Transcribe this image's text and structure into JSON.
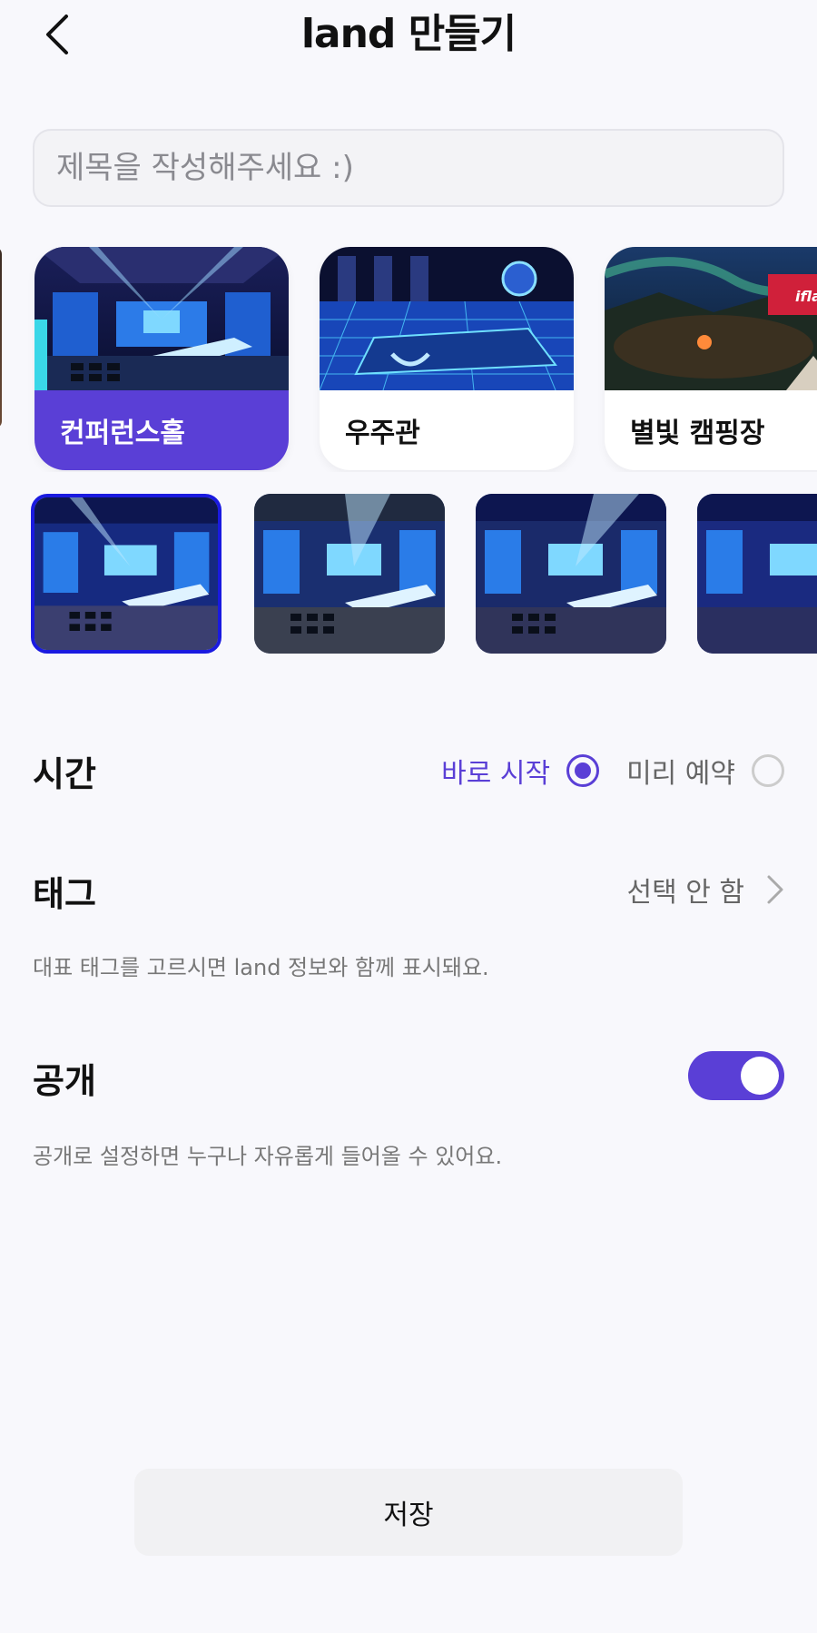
{
  "header": {
    "title": "land 만들기"
  },
  "title_input": {
    "placeholder": "제목을 작성해주세요 :)"
  },
  "lands": [
    {
      "label": "컨퍼런스홀",
      "selected": true
    },
    {
      "label": "우주관",
      "selected": false
    },
    {
      "label": "별빛 캠핑장",
      "selected": false,
      "badge": "ifland"
    }
  ],
  "time": {
    "label": "시간",
    "options": [
      {
        "label": "바로 시작",
        "selected": true
      },
      {
        "label": "미리 예약",
        "selected": false
      }
    ]
  },
  "tag": {
    "label": "태그",
    "value": "선택 안 함",
    "help": "대표 태그를 고르시면 land 정보와 함께 표시돼요."
  },
  "public": {
    "label": "공개",
    "enabled": true,
    "help": "공개로 설정하면 누구나 자유롭게 들어올 수 있어요."
  },
  "save_button": {
    "label": "저장"
  },
  "colors": {
    "accent": "#5a3fd6",
    "background": "#f8f8fc",
    "selected_thumb_border": "#1a1ae0"
  }
}
